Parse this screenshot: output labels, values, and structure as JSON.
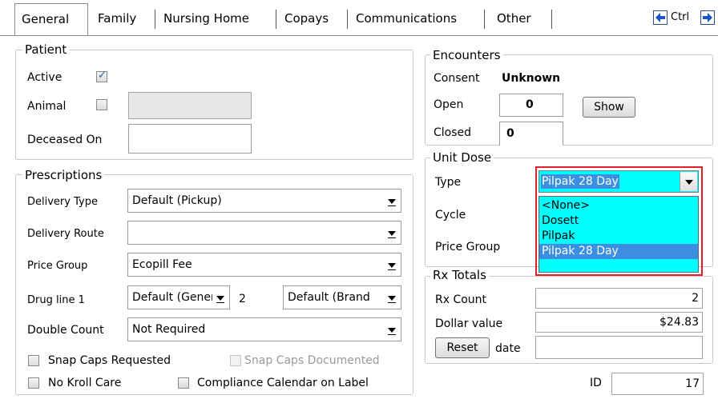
{
  "tabs": [
    {
      "label": "General",
      "active": true
    },
    {
      "label": "Family"
    },
    {
      "label": "Nursing Home"
    },
    {
      "label": "Copays"
    },
    {
      "label": "Communications"
    },
    {
      "label": "Other"
    }
  ],
  "nav": {
    "ctrl_label": "Ctrl",
    "left_icon": "arrow-left-icon",
    "right_icon": "arrow-right-icon"
  },
  "patient": {
    "legend": "Patient",
    "active_label": "Active",
    "active_checked": true,
    "animal_label": "Animal",
    "animal_checked": false,
    "deceased_label": "Deceased On",
    "deceased_value": ""
  },
  "prescriptions": {
    "legend": "Prescriptions",
    "delivery_type_label": "Delivery Type",
    "delivery_type_value": "Default (Pickup)",
    "delivery_route_label": "Delivery Route",
    "delivery_route_value": "",
    "price_group_label": "Price Group",
    "price_group_value": "Ecopill Fee",
    "drug_line_label": "Drug line 1",
    "drug_line_1_value": "Default (Gener",
    "drug_line_2_label": "2",
    "drug_line_2_value": "Default (Brand",
    "double_count_label": "Double Count",
    "double_count_value": "Not Required",
    "snap_caps_requested": "Snap Caps Requested",
    "snap_caps_documented": "Snap Caps Documented",
    "no_kroll_care": "No Kroll Care",
    "compliance_calendar": "Compliance Calendar on Label"
  },
  "encounters": {
    "legend": "Encounters",
    "consent_label": "Consent",
    "consent_value": "Unknown",
    "open_label": "Open",
    "open_value": "0",
    "closed_label": "Closed",
    "closed_value": "0",
    "show_button": "Show"
  },
  "unit_dose": {
    "legend": "Unit Dose",
    "type_label": "Type",
    "type_value": "Pilpak 28 Day",
    "cycle_label": "Cycle",
    "price_group_label": "Price Group",
    "options": [
      "<None>",
      "Dosett",
      "Pilpak",
      "Pilpak 28 Day"
    ],
    "highlight_color": "#3c8fe0",
    "list_bg_color": "#00ffff",
    "focus_border_color": "#e0202a"
  },
  "rx_totals": {
    "legend": "Rx Totals",
    "rx_count_label": "Rx Count",
    "rx_count_value": "2",
    "dollar_label": "Dollar value",
    "dollar_value": "$24.83",
    "reset_button": "Reset",
    "date_label": "date",
    "date_value": ""
  },
  "id_field": {
    "label": "ID",
    "value": "17"
  }
}
